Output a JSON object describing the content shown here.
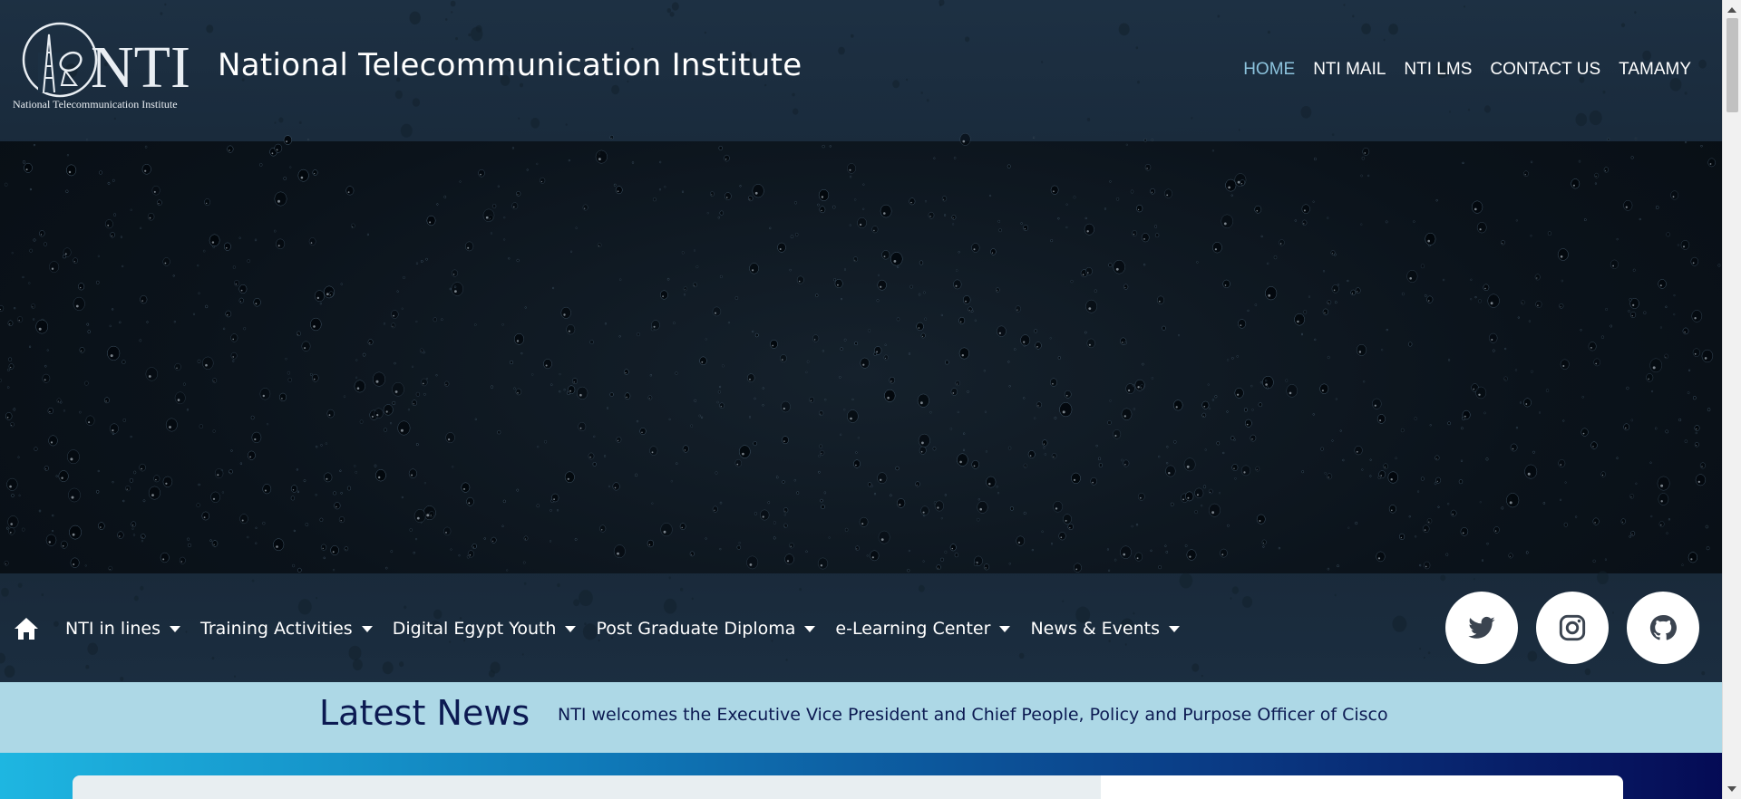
{
  "header": {
    "logo_caption": "National Telecommunication Institute",
    "logo_mark": "NTI",
    "site_title": "National Telecommunication Institute"
  },
  "top_nav": [
    {
      "label": "HOME",
      "active": true
    },
    {
      "label": "NTI MAIL",
      "active": false
    },
    {
      "label": "NTI LMS",
      "active": false
    },
    {
      "label": "CONTACT US",
      "active": false
    },
    {
      "label": "TAMAMY",
      "active": false
    }
  ],
  "main_nav": {
    "home_icon": "home-icon",
    "items": [
      {
        "label": "NTI in lines"
      },
      {
        "label": "Training Activities"
      },
      {
        "label": "Digital Egypt Youth"
      },
      {
        "label": "Post Graduate Diploma"
      },
      {
        "label": "e-Learning Center"
      },
      {
        "label": "News & Events"
      }
    ]
  },
  "social": [
    {
      "icon": "twitter-icon"
    },
    {
      "icon": "instagram-icon"
    },
    {
      "icon": "github-icon"
    }
  ],
  "news": {
    "title": "Latest News",
    "ticker": "NTI welcomes the Executive Vice President and Chief People, Policy and Purpose Officer of Cisco"
  },
  "colors": {
    "active_link": "#8cc3dd",
    "news_bar": "#add8e6",
    "news_text": "#0c1a52"
  }
}
